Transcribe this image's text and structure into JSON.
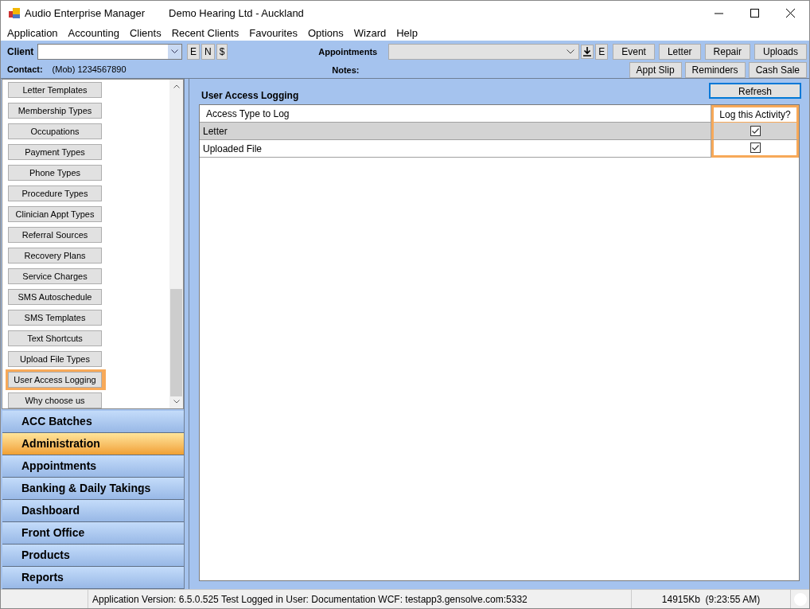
{
  "window": {
    "app_title": "Audio Enterprise Manager",
    "location": "Demo Hearing Ltd - Auckland"
  },
  "menu": [
    "Application",
    "Accounting",
    "Clients",
    "Recent Clients",
    "Favourites",
    "Options",
    "Wizard",
    "Help"
  ],
  "toolbar": {
    "client_label": "Client",
    "client_buttons": [
      "E",
      "N",
      "$"
    ],
    "contact_label": "Contact:",
    "contact_value": "(Mob) 1234567890",
    "appointments_label": "Appointments",
    "appt_buttons": [
      "E"
    ],
    "notes_label": "Notes:",
    "row1_buttons": [
      "Event",
      "Letter",
      "Repair",
      "Uploads"
    ],
    "row2_buttons": [
      "Appt Slip",
      "Reminders",
      "Cash Sale"
    ]
  },
  "admin_items": [
    {
      "label": "Letter Templates",
      "highlighted": false
    },
    {
      "label": "Membership Types",
      "highlighted": false
    },
    {
      "label": "Occupations",
      "highlighted": false
    },
    {
      "label": "Payment Types",
      "highlighted": false
    },
    {
      "label": "Phone Types",
      "highlighted": false
    },
    {
      "label": "Procedure Types",
      "highlighted": false
    },
    {
      "label": "Clinician Appt Types",
      "highlighted": false
    },
    {
      "label": "Referral Sources",
      "highlighted": false
    },
    {
      "label": "Recovery Plans",
      "highlighted": false
    },
    {
      "label": "Service Charges",
      "highlighted": false
    },
    {
      "label": "SMS Autoschedule",
      "highlighted": false
    },
    {
      "label": "SMS Templates",
      "highlighted": false
    },
    {
      "label": "Text Shortcuts",
      "highlighted": false
    },
    {
      "label": "Upload File Types",
      "highlighted": false
    },
    {
      "label": "User Access Logging",
      "highlighted": true
    },
    {
      "label": "Why choose us",
      "highlighted": false
    }
  ],
  "nav": [
    {
      "label": "ACC Batches",
      "selected": false
    },
    {
      "label": "Administration",
      "selected": true
    },
    {
      "label": "Appointments",
      "selected": false
    },
    {
      "label": "Banking & Daily Takings",
      "selected": false
    },
    {
      "label": "Dashboard",
      "selected": false
    },
    {
      "label": "Front Office",
      "selected": false
    },
    {
      "label": "Products",
      "selected": false
    },
    {
      "label": "Reports",
      "selected": false
    }
  ],
  "panel": {
    "title": "User Access Logging",
    "refresh_button": "Refresh",
    "columns": [
      {
        "label": "Access Type to Log",
        "highlighted": false
      },
      {
        "label": "Log this Activity?",
        "highlighted": true
      }
    ],
    "rows": [
      {
        "access_type": "Letter",
        "log": true,
        "selected": true
      },
      {
        "access_type": "Uploaded File",
        "log": true,
        "selected": false
      }
    ]
  },
  "status_bar": {
    "info": "Application Version: 6.5.0.525 Test  Logged in User: Documentation WCF: testapp3.gensolve.com:5332",
    "memory": "14915Kb  (9:23:55 AM)"
  }
}
